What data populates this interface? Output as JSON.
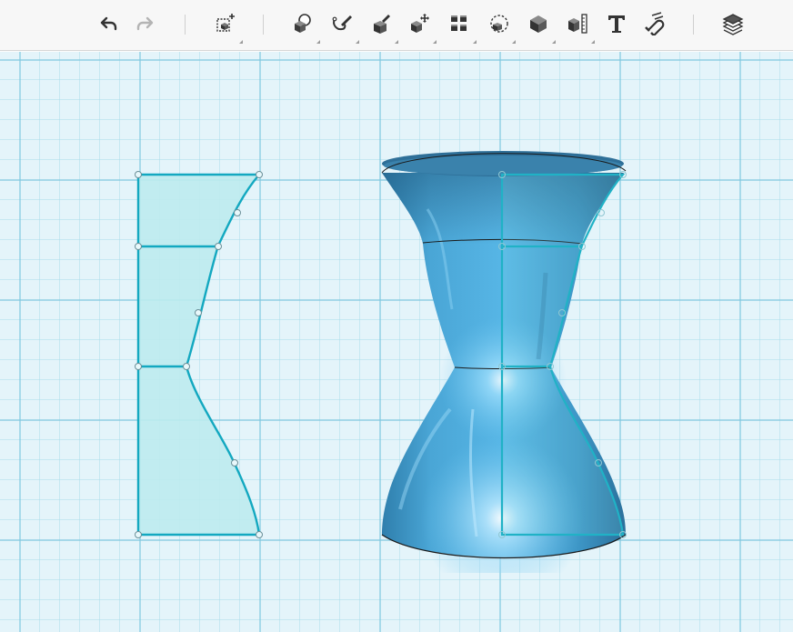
{
  "toolbar": {
    "history": [
      {
        "name": "undo-icon",
        "enabled": true
      },
      {
        "name": "redo-icon",
        "enabled": false
      }
    ],
    "groups": [
      [
        "add-primitive-icon"
      ],
      [
        "primitives-icon",
        "sketch-icon",
        "construct-icon",
        "modify-icon",
        "pattern-icon",
        "grouping-icon",
        "combine-icon",
        "measure-icon",
        "text-icon",
        "snap-icon"
      ],
      [
        "materials-icon"
      ]
    ]
  },
  "viewport": {
    "grid_color": "#8fd0e4",
    "sketch_color": "#13a8c0",
    "sketch_fill": "#bdebee",
    "solid_color": "#3d95c4"
  }
}
